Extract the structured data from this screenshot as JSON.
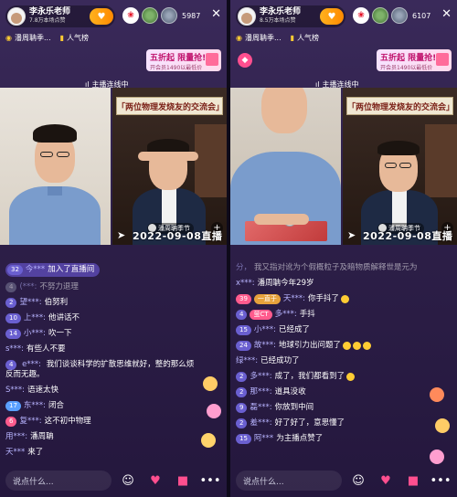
{
  "colors": {
    "accent": "#ff4f8f",
    "follow": "#ffb21e",
    "username": "#b8b4ff"
  },
  "left": {
    "host": {
      "name": "李永乐老师",
      "fans": "7.8万本场点赞"
    },
    "viewer_count": "5987",
    "tabs": [
      {
        "label": "潘周聃季..."
      },
      {
        "label": "人气榜"
      }
    ],
    "promo": {
      "line1": "五折起 限量抢!",
      "line2": "开会员1490以最低价"
    },
    "link_banner": "主播连线中",
    "feed_right_name": "潘周聃季节",
    "stamp": "2022-09-08直播",
    "right_banner": "「两位物理发烧友的交流会」",
    "chat": [
      {
        "badge": "32",
        "user": "今***",
        "text": "加入了直播间",
        "type": "join"
      },
      {
        "badge": "4",
        "user": "(***:",
        "text": "不努力退理",
        "type": "faded"
      },
      {
        "badge": "2",
        "user": "望***:",
        "text": "伯努利"
      },
      {
        "badge": "10",
        "user": "上***:",
        "text": "他讲话不"
      },
      {
        "badge": "14",
        "user": "小***:",
        "text": "吹一下"
      },
      {
        "badge": "",
        "user": "s***:",
        "text": "有些人不要"
      },
      {
        "badge": "4",
        "user": "e***:",
        "text": "我们谈谈科学的扩散思维就好，整的那么烦反而无趣。",
        "type": "wrap"
      },
      {
        "badge": "",
        "user": "S***:",
        "text": "语速太快"
      },
      {
        "badge": "17",
        "user": "东***:",
        "text": "闭合"
      },
      {
        "badge": "6",
        "user": "复***:",
        "text": "这不初中物理"
      },
      {
        "badge": "",
        "user": "用***:",
        "text": "潘周聃"
      },
      {
        "badge": "",
        "user": "天***",
        "text": "来了"
      }
    ],
    "input_placeholder": "说点什么..."
  },
  "right": {
    "host": {
      "name": "李永乐老师",
      "fans": "8.5万本场点赞"
    },
    "viewer_count": "6107",
    "tabs": [
      {
        "label": "潘周聃季..."
      },
      {
        "label": "人气榜"
      }
    ],
    "promo": {
      "line1": "五折起 限量抢!",
      "line2": "开会员1490以最低价"
    },
    "link_banner": "主播连线中",
    "feed_right_name": "潘周聃季节",
    "stamp": "2022-09-08直播",
    "right_banner": "「两位物理发烧友的交流会」",
    "chat": [
      {
        "badge": "",
        "user": "分，",
        "text": "我又指对讹为个假概粒子及暗物质解释世是元为",
        "type": "faded"
      },
      {
        "badge": "",
        "user": "x***:",
        "text": "潘周聃今年29岁"
      },
      {
        "badge": "39",
        "user": "天***:",
        "text": "你手抖了",
        "emoji": true,
        "badge2": "一直于"
      },
      {
        "badge": "4",
        "user": "多***:",
        "text": "手抖",
        "badge2": "萤CT"
      },
      {
        "badge": "15",
        "user": "小***:",
        "text": "已经成了"
      },
      {
        "badge": "24",
        "user": "故***:",
        "text": "地球引力出问题了",
        "emoji": true
      },
      {
        "badge": "",
        "user": "绿***:",
        "text": "已经成功了"
      },
      {
        "badge": "2",
        "user": "多***:",
        "text": "成了，我们都看到了",
        "emoji": true
      },
      {
        "badge": "2",
        "user": "那***:",
        "text": "道具没收"
      },
      {
        "badge": "9",
        "user": "磊***:",
        "text": "你放到中间"
      },
      {
        "badge": "2",
        "user": "羞***:",
        "text": "好了好了，意思懂了"
      },
      {
        "badge": "15",
        "user": "阿***",
        "text": "为主播点赞了"
      }
    ],
    "input_placeholder": "说点什么..."
  }
}
